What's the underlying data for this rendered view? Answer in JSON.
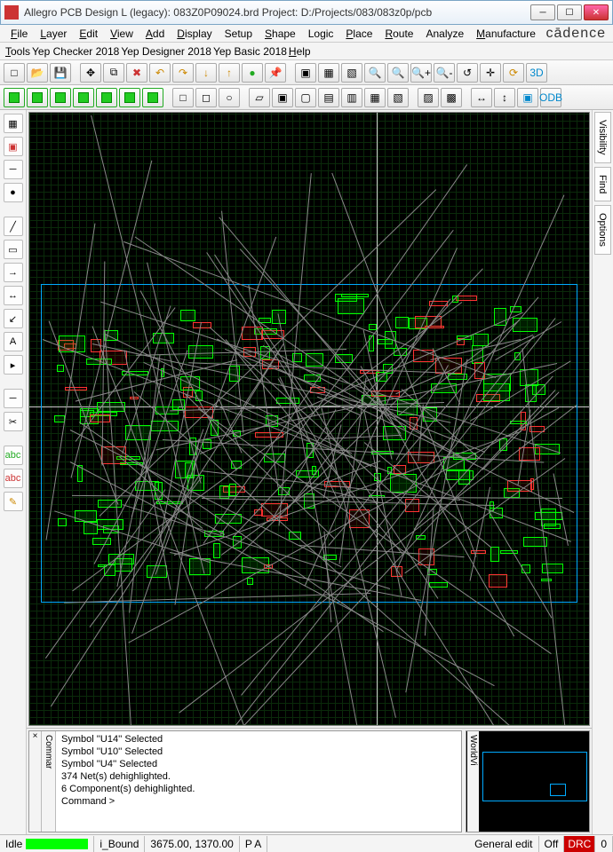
{
  "window": {
    "title": "Allegro PCB Design L (legacy): 083Z0P09024.brd   Project: D:/Projects/083/083z0p/pcb"
  },
  "menus_row1": [
    {
      "label": "File",
      "u": "F"
    },
    {
      "label": "Layer",
      "u": "L"
    },
    {
      "label": "Edit",
      "u": "E"
    },
    {
      "label": "View",
      "u": "V"
    },
    {
      "label": "Add",
      "u": "A"
    },
    {
      "label": "Display",
      "u": "D"
    },
    {
      "label": "Setup",
      "u": ""
    },
    {
      "label": "Shape",
      "u": "S"
    },
    {
      "label": "Logic",
      "u": ""
    },
    {
      "label": "Place",
      "u": "P"
    },
    {
      "label": "Route",
      "u": "R"
    },
    {
      "label": "Analyze",
      "u": ""
    },
    {
      "label": "Manufacture",
      "u": "M"
    }
  ],
  "menus_row2": [
    {
      "label": "Tools",
      "u": "T"
    },
    {
      "label": "Yep Checker 2018",
      "u": ""
    },
    {
      "label": "Yep Designer 2018",
      "u": ""
    },
    {
      "label": "Yep Basic 2018",
      "u": ""
    },
    {
      "label": "Help",
      "u": "H"
    }
  ],
  "brand": "cādence",
  "toolbar1": [
    {
      "name": "new-icon",
      "g": "□"
    },
    {
      "name": "open-icon",
      "g": "📂"
    },
    {
      "name": "save-icon",
      "g": "💾"
    },
    {
      "sep": true
    },
    {
      "name": "move-icon",
      "g": "✥"
    },
    {
      "name": "copy-icon",
      "g": "⧉"
    },
    {
      "name": "delete-icon",
      "g": "✖",
      "c": "#c33"
    },
    {
      "name": "undo-icon",
      "g": "↶",
      "c": "#c80"
    },
    {
      "name": "redo-icon",
      "g": "↷",
      "c": "#c80"
    },
    {
      "name": "down-icon",
      "g": "↓",
      "c": "#c80"
    },
    {
      "name": "up-icon",
      "g": "↑",
      "c": "#c80"
    },
    {
      "name": "apply-icon",
      "g": "●",
      "c": "#2a2"
    },
    {
      "name": "pin-icon",
      "g": "📌",
      "c": "#2a2"
    },
    {
      "sep": true
    },
    {
      "name": "zoom-window-icon",
      "g": "▣"
    },
    {
      "name": "zoom-fit-icon",
      "g": "▦"
    },
    {
      "name": "zoom-select-icon",
      "g": "▧"
    },
    {
      "name": "zoom-icon",
      "g": "🔍"
    },
    {
      "name": "zoom-out-path-icon",
      "g": "🔍"
    },
    {
      "name": "zoom-in-icon",
      "g": "🔍+"
    },
    {
      "name": "zoom-out-icon",
      "g": "🔍-"
    },
    {
      "name": "zoom-prev-icon",
      "g": "↺"
    },
    {
      "name": "pan-icon",
      "g": "✛"
    },
    {
      "name": "refresh-icon",
      "g": "⟳",
      "c": "#c80"
    },
    {
      "name": "3d-icon",
      "g": "3D",
      "c": "#08c"
    }
  ],
  "toolbar2": [
    {
      "name": "sel-1-icon",
      "green": true
    },
    {
      "name": "sel-2-icon",
      "green": true
    },
    {
      "name": "sel-3-icon",
      "green": true
    },
    {
      "name": "sel-4-icon",
      "green": true
    },
    {
      "name": "sel-5-icon",
      "green": true
    },
    {
      "name": "sel-6-icon",
      "green": true
    },
    {
      "name": "sel-7-icon",
      "green": true
    },
    {
      "sep": true
    },
    {
      "name": "shape-rect-icon",
      "g": "□"
    },
    {
      "name": "shape-sq-icon",
      "g": "◻"
    },
    {
      "name": "shape-circ-icon",
      "g": "○"
    },
    {
      "sep": true
    },
    {
      "name": "cursor-icon",
      "g": "▱"
    },
    {
      "name": "group-icon",
      "g": "▣"
    },
    {
      "name": "ungroup-icon",
      "g": "▢"
    },
    {
      "name": "assign-icon",
      "g": "▤"
    },
    {
      "name": "unassign-icon",
      "g": "▥"
    },
    {
      "name": "class-icon",
      "g": "▦"
    },
    {
      "name": "color-icon",
      "g": "▧"
    },
    {
      "sep": true
    },
    {
      "name": "constraint-icon",
      "g": "▨"
    },
    {
      "name": "region-icon",
      "g": "▩"
    },
    {
      "sep": true
    },
    {
      "name": "hline-icon",
      "g": "↔"
    },
    {
      "name": "vline-icon",
      "g": "↕"
    },
    {
      "name": "export-icon",
      "g": "▣",
      "c": "#08c"
    },
    {
      "name": "odb-icon",
      "g": "ODB",
      "c": "#08c"
    }
  ],
  "left_tools": [
    {
      "name": "place-comp-icon",
      "g": "▦"
    },
    {
      "name": "place-ref-icon",
      "g": "▣",
      "c": "#c33"
    },
    {
      "name": "route-icon",
      "g": "─"
    },
    {
      "name": "via-icon",
      "g": "●"
    },
    {
      "sep": true
    },
    {
      "name": "line-draw-icon",
      "g": "╱"
    },
    {
      "name": "rect-draw-icon",
      "g": "▭"
    },
    {
      "name": "arrow-draw-icon",
      "g": "→"
    },
    {
      "name": "dim-icon",
      "g": "↔"
    },
    {
      "name": "leader-icon",
      "g": "↙"
    },
    {
      "name": "text-tool-icon",
      "g": "A"
    },
    {
      "name": "probe-icon",
      "g": "▸"
    },
    {
      "sep": true
    },
    {
      "name": "cut-line-icon",
      "g": "─"
    },
    {
      "name": "trim-icon",
      "g": "✂"
    },
    {
      "sep": true
    },
    {
      "name": "abc-add-icon",
      "g": "abc",
      "c": "#2a2"
    },
    {
      "name": "abc-del-icon",
      "g": "abc",
      "c": "#c33"
    },
    {
      "name": "pencil-icon",
      "g": "✎",
      "c": "#c80"
    }
  ],
  "right_tabs": [
    "Visibility",
    "Find",
    "Options"
  ],
  "console": {
    "tab": "Commar",
    "lines": [
      "Symbol ''U14'' Selected",
      "Symbol ''U10'' Selected",
      "Symbol ''U4'' Selected",
      "374 Net(s) dehighlighted.",
      "6 Component(s) dehighlighted.",
      "Command >"
    ]
  },
  "worldview": {
    "tab": "WorldVi"
  },
  "status": {
    "mode": "Idle",
    "layer": "i_Bound",
    "coords": "3675.00, 1370.00",
    "flags": "P  A",
    "edit": "General edit",
    "ratsnest": "Off",
    "drc_label": "DRC",
    "drc_count": "0"
  },
  "colors": {
    "accent": "#08c",
    "pcb_green": "#0f0",
    "pcb_red": "#f33"
  }
}
